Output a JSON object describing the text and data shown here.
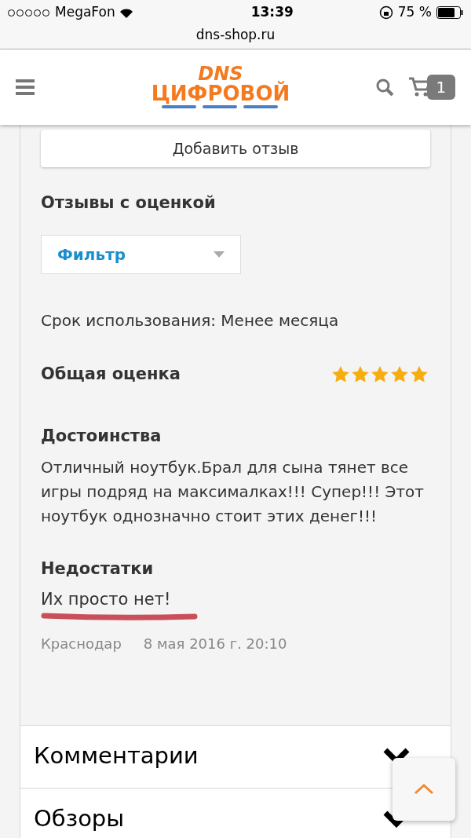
{
  "status_bar": {
    "carrier": "MegaFon",
    "time": "13:39",
    "battery": "75 %"
  },
  "address_bar": {
    "url": "dns-shop.ru"
  },
  "header": {
    "logo_top": "DNS",
    "logo_bottom": "ЦИФРОВОЙ",
    "cart_count": "1"
  },
  "add_review_button": "Добавить отзыв",
  "reviews_heading": "Отзывы с оценкой",
  "filter": {
    "value": "Фильтр"
  },
  "review": {
    "usage": "Срок использования: Менее месяца",
    "rating_label": "Общая оценка",
    "stars": 5,
    "pros_title": "Достоинства",
    "pros": "Отличный ноутбук.Брал для сына тянет все игры подряд на максималках!!! Супер!!! Этот ноутбук однозначно стоит этих денег!!!",
    "cons_title": "Недостатки",
    "cons": "Их просто нет!",
    "city": "Краснодар",
    "date": "8 мая 2016 г. 20:10"
  },
  "sections": [
    {
      "title": "Комментарии"
    },
    {
      "title": "Обзоры"
    }
  ]
}
